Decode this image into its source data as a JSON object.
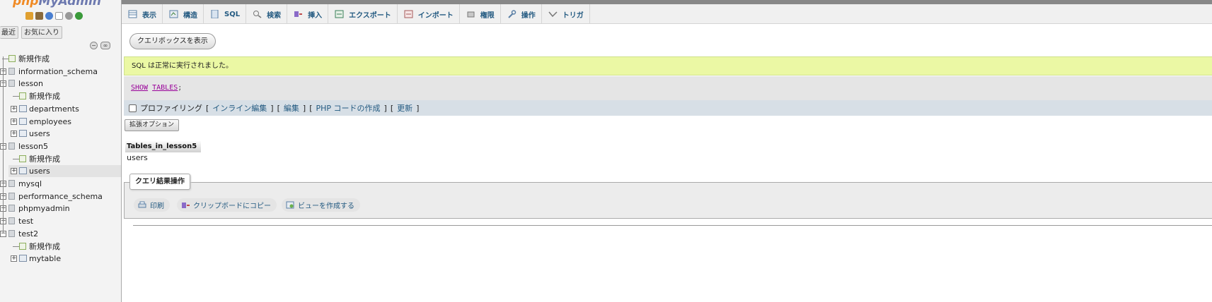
{
  "nav": {
    "logo_part1": "php",
    "logo_part2": "MyAdmin",
    "tabs": [
      "最近",
      "お気に入り"
    ],
    "tree": [
      {
        "label": "新規作成",
        "kind": "new",
        "depth": 0
      },
      {
        "label": "information_schema",
        "kind": "db",
        "depth": 0
      },
      {
        "label": "lesson",
        "kind": "db",
        "depth": 0
      },
      {
        "label": "新規作成",
        "kind": "new",
        "depth": 1
      },
      {
        "label": "departments",
        "kind": "table",
        "depth": 1
      },
      {
        "label": "employees",
        "kind": "table",
        "depth": 1
      },
      {
        "label": "users",
        "kind": "table",
        "depth": 1
      },
      {
        "label": "lesson5",
        "kind": "db",
        "depth": 0
      },
      {
        "label": "新規作成",
        "kind": "new",
        "depth": 1
      },
      {
        "label": "users",
        "kind": "table",
        "depth": 1,
        "selected": true
      },
      {
        "label": "mysql",
        "kind": "db",
        "depth": 0
      },
      {
        "label": "performance_schema",
        "kind": "db",
        "depth": 0
      },
      {
        "label": "phpmyadmin",
        "kind": "db",
        "depth": 0
      },
      {
        "label": "test",
        "kind": "db",
        "depth": 0
      },
      {
        "label": "test2",
        "kind": "db",
        "depth": 0
      },
      {
        "label": "新規作成",
        "kind": "new",
        "depth": 1
      },
      {
        "label": "mytable",
        "kind": "table",
        "depth": 1
      }
    ]
  },
  "menu": {
    "tabs": [
      {
        "label": "表示",
        "icon": "browse-icon"
      },
      {
        "label": "構造",
        "icon": "structure-icon"
      },
      {
        "label": "SQL",
        "icon": "sql-icon"
      },
      {
        "label": "検索",
        "icon": "search-icon"
      },
      {
        "label": "挿入",
        "icon": "insert-icon"
      },
      {
        "label": "エクスポート",
        "icon": "export-icon"
      },
      {
        "label": "インポート",
        "icon": "import-icon"
      },
      {
        "label": "権限",
        "icon": "privileges-icon"
      },
      {
        "label": "操作",
        "icon": "wrench-icon"
      },
      {
        "label": "トリガ",
        "icon": "triggers-icon"
      }
    ]
  },
  "main": {
    "show_query_box": "クエリボックスを表示",
    "success_message": "SQL は正常に実行されました。",
    "sql_keyword1": "SHOW",
    "sql_keyword2": "TABLES",
    "sql_tail": ";",
    "profiling_label": "プロファイリング",
    "open_bracket": "[",
    "close_bracket": "]",
    "links": [
      "インライン編集",
      "編集",
      "PHP コードの作成",
      "更新"
    ],
    "extra_options": "拡張オプション",
    "result_header": "Tables_in_lesson5",
    "result_rows": [
      "users"
    ],
    "ops_legend": "クエリ結果操作",
    "ops": [
      {
        "label": "印刷",
        "icon": "print-icon"
      },
      {
        "label": "クリップボードにコピー",
        "icon": "copy-icon"
      },
      {
        "label": "ビューを作成する",
        "icon": "create-view-icon"
      }
    ]
  }
}
